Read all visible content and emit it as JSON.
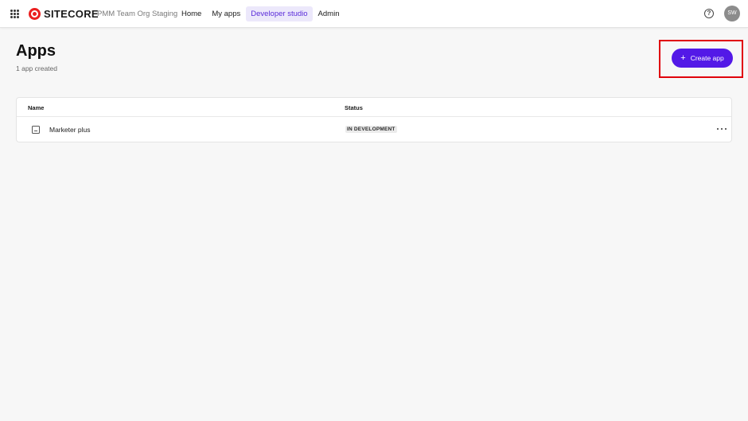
{
  "topbar": {
    "logo_text": "SITECORE",
    "org_name": "PMM Team Org Staging",
    "nav": [
      {
        "label": "Home",
        "active": false
      },
      {
        "label": "My apps",
        "active": false
      },
      {
        "label": "Developer studio",
        "active": true
      },
      {
        "label": "Admin",
        "active": false
      }
    ],
    "help_icon_glyph": "?",
    "avatar_initials": "SW",
    "icons": [
      "app-switcher-grid-icon",
      "sitecore-logo-icon",
      "help-icon"
    ]
  },
  "header": {
    "title": "Apps",
    "subtitle": "1 app created",
    "create_button": {
      "icon": "plus-icon",
      "glyph": "+",
      "label": "Create app"
    }
  },
  "table": {
    "columns": [
      "Name",
      "Status"
    ],
    "rows": [
      {
        "icon": "image-icon",
        "name": "Marketer plus",
        "status": "IN DEVELOPMENT",
        "actions_icon": "more-horizontal-icon"
      }
    ]
  },
  "colors": {
    "primary": "#5319e7",
    "nav_active_bg": "#ece8fb",
    "nav_active_text": "#5a2bd9",
    "logo_red": "#eb1f1f",
    "highlight_red": "#e0000b",
    "page_bg": "#f7f7f7"
  }
}
